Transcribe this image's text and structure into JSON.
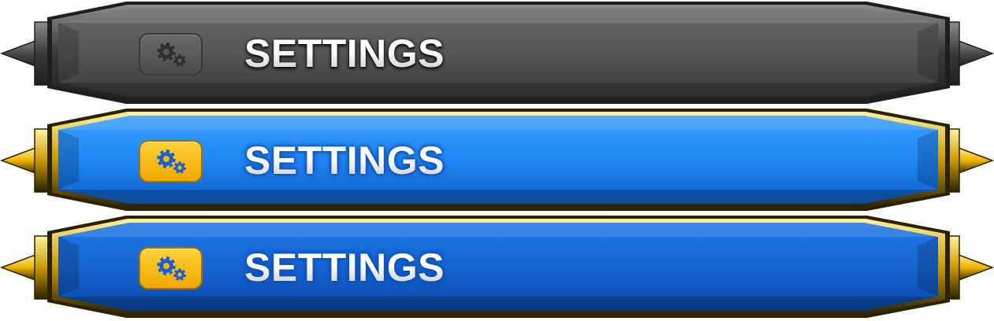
{
  "buttons": [
    {
      "id": "dark",
      "label": "SETTINGS",
      "icon": "gears-icon",
      "state": "disabled",
      "colors": {
        "outer": "#1f1f1f",
        "rim": "#3a3a3a",
        "face_top": "#6a6a6a",
        "face_mid": "#555555",
        "face_bottom": "#3c3c3c",
        "spike": "#4a4a4a",
        "spike_light": "#8c8c8c",
        "gear": "#2f2f2f"
      }
    },
    {
      "id": "blue-light",
      "label": "SETTINGS",
      "icon": "gears-icon",
      "state": "hover",
      "colors": {
        "outer": "#2b2200",
        "rim": "#c99a00",
        "face_top": "#3aa0ff",
        "face_mid": "#1f86f5",
        "face_bottom": "#0f5fc8",
        "spike": "#f0b400",
        "spike_light": "#fff2a0",
        "gear": "#1b5fd6"
      }
    },
    {
      "id": "blue-dark",
      "label": "SETTINGS",
      "icon": "gears-icon",
      "state": "normal",
      "colors": {
        "outer": "#2b2200",
        "rim": "#c99a00",
        "face_top": "#1f78e6",
        "face_mid": "#1565d2",
        "face_bottom": "#0b4aa8",
        "spike": "#f0b400",
        "spike_light": "#fff2a0",
        "gear": "#1b5fd6"
      }
    }
  ]
}
